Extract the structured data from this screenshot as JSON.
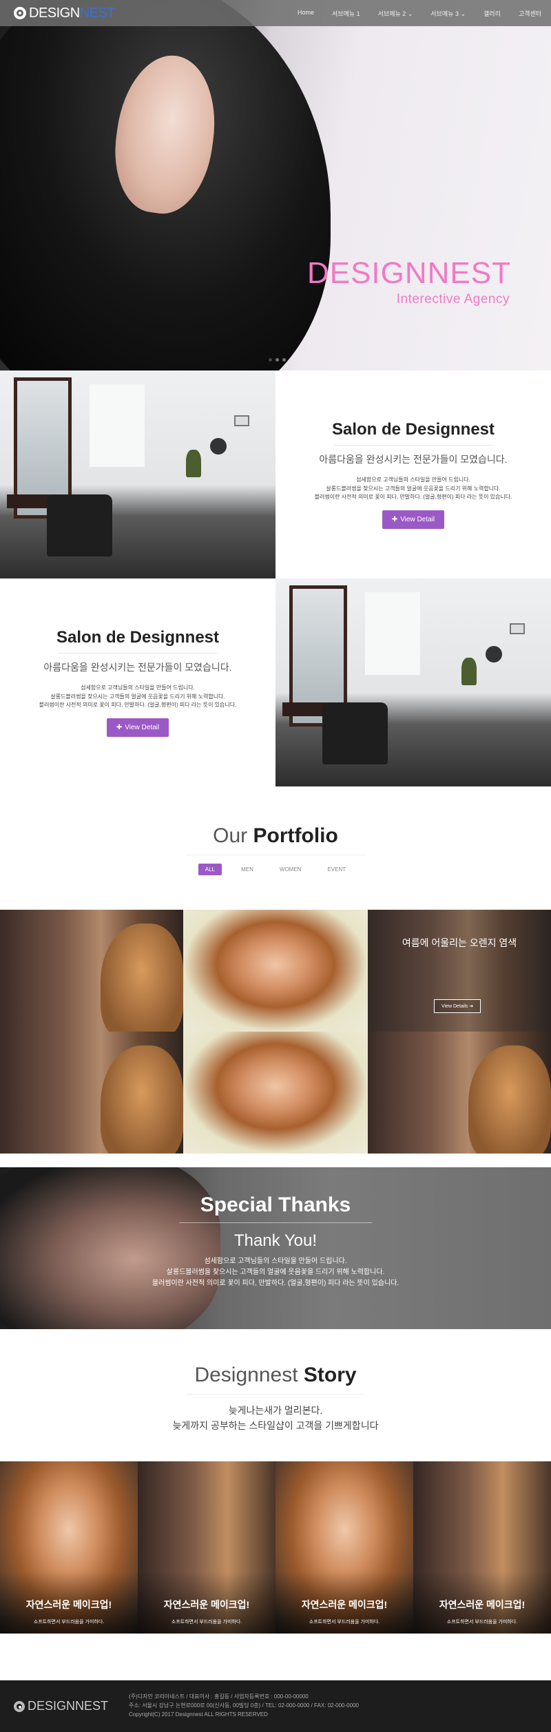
{
  "nav": {
    "logo_a": "DESIGN",
    "logo_b": "NEST",
    "items": [
      "Home",
      "서브메뉴 1",
      "서브메뉴 2 ⌄",
      "서브메뉴 3 ⌄",
      "갤러리",
      "고객센터"
    ]
  },
  "hero": {
    "title": "DESIGNNEST",
    "subtitle": "Interective Agency"
  },
  "salon1": {
    "title": "Salon de Designnest",
    "lead": "아름다움을 완성시키는 전문가들이 모였습니다.",
    "desc": [
      "섬세함으로 고객님들의 스타일을 만들어 드립니다.",
      "살롱드블러썸을 찾으시는 고객들의 얼굴에 웃음꽃을 드리기 위해 노력합니다.",
      "블러썸이란 사전적 의미로 꽃이 피다, 만발하다. (얼굴,형편이) 피다 라는 뜻이 있습니다."
    ],
    "button": "View Detail"
  },
  "salon2": {
    "title": "Salon de Designnest",
    "lead": "아름다움을 완성시키는 전문가들이 모였습니다.",
    "desc": [
      "섬세함으로 고객님들의 스타일을 만들어 드립니다.",
      "살롱드블러썸을 찾으시는 고객들의 얼굴에 웃음꽃을 드리기 위해 노력합니다.",
      "블러썸이란 사전적 의미로 꽃이 피다, 만발하다. (얼굴,형편이) 피다 라는 뜻이 있습니다."
    ],
    "button": "View Detail"
  },
  "portfolio": {
    "title_a": "Our",
    "title_b": "Portfolio",
    "filters": [
      "ALL",
      "MEN",
      "WOMEN",
      "EVENT"
    ],
    "hover_caption": "여름에 어울리는 오렌지 염색",
    "hover_button": "View Details"
  },
  "thanks": {
    "title": "Special Thanks",
    "subtitle": "Thank You!",
    "lines": [
      "섬세함으로 고객님들의 스타일을 만들어 드립니다.",
      "살롱드블러썸을 찾으시는 고객들의 얼굴에 웃음꽃을 드리기 위해 노력합니다.",
      "블러썸이란 사전적 의미로 꽃이 피다, 만발하다. (얼굴,형편이) 피다 라는 뜻이 있습니다."
    ]
  },
  "story": {
    "title_a": "Designnest",
    "title_b": "Story",
    "lines": [
      "늦게나는새가 멀리본다.",
      "늦게까지 공부하는 스타일샵이 고객을 기쁘게합니다"
    ],
    "cards": [
      {
        "title": "자연스러운 메이크업!",
        "text": "소프트하면서 부드러움을 가미하다."
      },
      {
        "title": "자연스러운 메이크업!",
        "text": "소프트하면서 부드러움을 가미하다."
      },
      {
        "title": "자연스러운 메이크업!",
        "text": "소프트하면서 부드러움을 가미하다."
      },
      {
        "title": "자연스러운 메이크업!",
        "text": "소프트하면서 부드러움을 가미하다."
      }
    ]
  },
  "footer": {
    "logo": "DESIGNNEST",
    "line1": "(주)디자인 코리아네스트  /  대표이사 : 홍길동  /  사업자등록번호 : 000-00-00000",
    "line2": "주소: 서울시 강남구 논현로000로 00(신사동, 00빌딩 0층)  /  TEL: 02-000-0000  /  FAX: 02-000-0000",
    "line3": "Copyright(C) 2017 Designnest ALL RIGHTS RESERVED"
  },
  "colors": {
    "accent": "#9b59c6",
    "hero_text": "#f07ac4",
    "footer_bg": "#1d1d1d"
  }
}
